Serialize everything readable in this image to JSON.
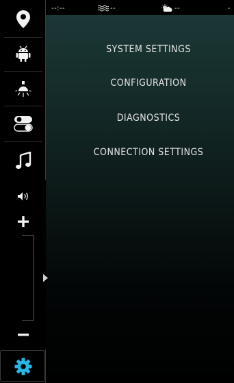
{
  "status": {
    "time": "--:--",
    "sea_temp": "--",
    "weather": "--",
    "extra": "-"
  },
  "menu": [
    {
      "label": "SYSTEM SETTINGS"
    },
    {
      "label": "CONFIGURATION"
    },
    {
      "label": "DIAGNOSTICS"
    },
    {
      "label": "CONNECTION SETTINGS"
    }
  ],
  "rail": {
    "icons": [
      "location-pin-icon",
      "android-icon",
      "light-bulb-icon",
      "toggle-switch-icon",
      "music-note-icon",
      "speaker-volume-icon",
      "plus-icon",
      "minus-icon",
      "gear-icon"
    ],
    "volume_level": 0.5
  },
  "colors": {
    "accent": "#27b7e6",
    "text": "#e6e6e6",
    "background_top": "#1c3a38"
  }
}
